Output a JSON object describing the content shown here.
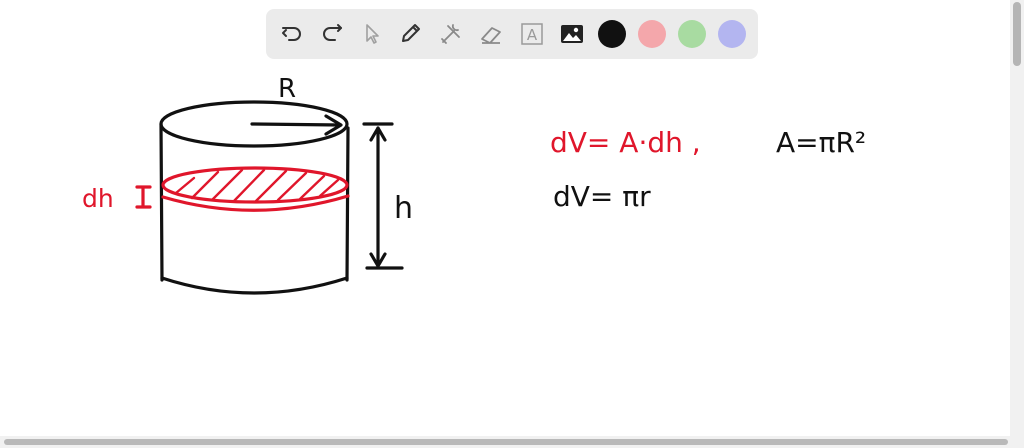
{
  "toolbar": {
    "tools": [
      {
        "name": "undo-icon",
        "label": "undo"
      },
      {
        "name": "redo-icon",
        "label": "redo"
      },
      {
        "name": "pointer-icon",
        "label": "select"
      },
      {
        "name": "pencil-icon",
        "label": "pen"
      },
      {
        "name": "tools-icon",
        "label": "tools"
      },
      {
        "name": "eraser-icon",
        "label": "eraser"
      },
      {
        "name": "text-icon",
        "label": "A"
      },
      {
        "name": "image-icon",
        "label": "image"
      }
    ],
    "text_tool_label": "A",
    "colors": {
      "black": "#111111",
      "red": "#f4a7ab",
      "green": "#a8dba1",
      "blue": "#b3b5f0"
    }
  },
  "drawing": {
    "label_R": "R",
    "label_h": "h",
    "label_dh": "dh",
    "eq1_left": "dV= A·dh ,",
    "eq1_right": "A=πR²",
    "eq2": "dV= πr",
    "ink_black": "#111111",
    "ink_red": "#e0162b"
  }
}
